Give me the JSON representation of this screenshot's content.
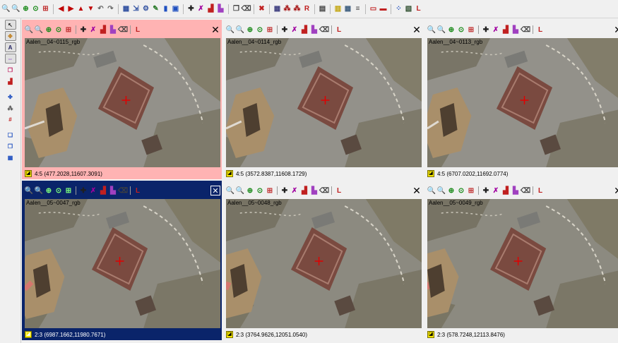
{
  "toolbar": {
    "icons": [
      "zoom-in-icon",
      "zoom-out-icon",
      "zoom-fit-icon",
      "zoom-window-icon",
      "zoom-grid-icon",
      "sep",
      "arrow-left-icon",
      "arrow-right-icon",
      "arrow-up-icon",
      "arrow-down-icon",
      "undo-icon",
      "redo-icon",
      "sep",
      "layout-icon",
      "export-icon",
      "settings-icon",
      "tools-icon",
      "book-icon",
      "monitor-icon",
      "sep",
      "add-point-icon",
      "measure-icon",
      "chart-icon",
      "chart-alt-icon",
      "sep",
      "stack-icon",
      "trash-icon",
      "sep",
      "config-icon",
      "sep",
      "grid-icon",
      "network-icon",
      "network-alt-icon",
      "report-icon",
      "sep",
      "document-icon",
      "sep",
      "calendar-icon",
      "table-icon",
      "filter-icon",
      "sep",
      "window-single-icon",
      "window-multi-icon",
      "sep",
      "group-icon",
      "photo-icon",
      "label-icon"
    ]
  },
  "sidebar": {
    "items": [
      {
        "icon": "pointer-tool-icon",
        "boxed": true
      },
      {
        "icon": "pan-tool-icon",
        "boxed": true
      },
      {
        "icon": "text-tool-icon",
        "boxed": true,
        "glyph": "A"
      },
      {
        "icon": "link-tool-icon",
        "boxed": true
      },
      {
        "icon": "stack-tool-icon",
        "boxed": false
      },
      {
        "icon": "chart-tool-icon",
        "boxed": false
      },
      {
        "icon": "gap",
        "boxed": false
      },
      {
        "icon": "puzzle-tool-icon",
        "boxed": false
      },
      {
        "icon": "network-tool-icon",
        "boxed": false
      },
      {
        "icon": "number-tool-icon",
        "boxed": false
      },
      {
        "icon": "gap",
        "boxed": false
      },
      {
        "icon": "copy-tool-icon",
        "boxed": false
      },
      {
        "icon": "paste-tool-icon",
        "boxed": false
      },
      {
        "icon": "grid-tool-icon",
        "boxed": false
      }
    ]
  },
  "panels": [
    {
      "label": "Aalen__04~0115_rgb",
      "status": "4:5 (477.2028,11607.3091)",
      "selected": "red"
    },
    {
      "label": "Aalen__04~0114_rgb",
      "status": "4:5 (3572.8387,11608.1729)",
      "selected": "none"
    },
    {
      "label": "Aalen__04~0113_rgb",
      "status": "4:5 (6707.0202,11692.0774)",
      "selected": "none"
    },
    {
      "label": "Aalen__05~0047_rgb",
      "status": "2:3 (6987.1662,11980.7671)",
      "selected": "blue"
    },
    {
      "label": "Aalen__05~0048_rgb",
      "status": "2:3 (3764.9626,12051.0540)",
      "selected": "none"
    },
    {
      "label": "Aalen__05~0049_rgb",
      "status": "2:3 (578.7248,12113.8476)",
      "selected": "none"
    }
  ],
  "panel_toolbar_icons": [
    "zoom-in-icon",
    "zoom-out-icon",
    "zoom-fit-icon",
    "zoom-window-icon",
    "zoom-grid-icon",
    "sep",
    "add-point-icon",
    "measure-icon",
    "chart-icon",
    "chart-alt-icon",
    "trash-icon",
    "sep",
    "label-icon"
  ],
  "colors": {
    "selected_red": "#ffb3b3",
    "selected_blue": "#0a246a",
    "crosshair": "#e00000"
  },
  "close_glyph": "✕",
  "note_glyph": "◪"
}
